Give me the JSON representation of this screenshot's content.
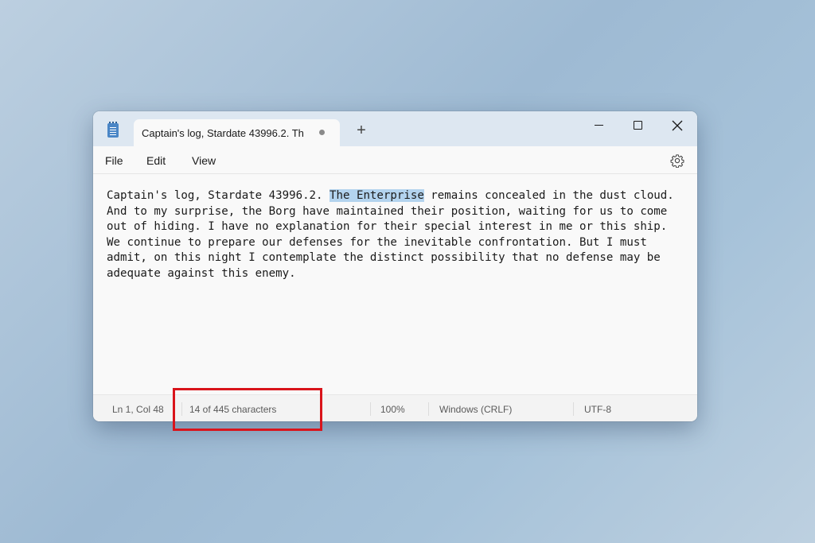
{
  "window": {
    "tab_title": "Captain's log, Stardate 43996.2. Th",
    "new_tab_symbol": "+"
  },
  "menu": {
    "file": "File",
    "edit": "Edit",
    "view": "View"
  },
  "editor": {
    "lines": [
      {
        "before": "Captain's log, Stardate 43996.2. ",
        "selected": "The Enterprise",
        "after": " remains concealed in the dust cloud."
      },
      {
        "before": "And to my surprise, the Borg have maintained their position, waiting for us to come",
        "selected": "",
        "after": ""
      },
      {
        "before": "out of hiding. I have no explanation for their special interest in me or this ship.",
        "selected": "",
        "after": ""
      },
      {
        "before": "We continue to prepare our defenses for the inevitable confrontation. But I must",
        "selected": "",
        "after": ""
      },
      {
        "before": "admit, on this night I contemplate the distinct possibility that no defense may be",
        "selected": "",
        "after": ""
      },
      {
        "before": "adequate against this enemy.",
        "selected": "",
        "after": ""
      }
    ],
    "selection_color": "#b3d3ee"
  },
  "status": {
    "position": "Ln 1, Col 48",
    "characters": "14 of 445 characters",
    "zoom": "100%",
    "line_ending": "Windows (CRLF)",
    "encoding": "UTF-8"
  },
  "icons": {
    "app": "notepad-icon",
    "settings": "gear-icon",
    "minimize": "minimize-icon",
    "maximize": "maximize-icon",
    "close": "close-icon"
  },
  "annotation": {
    "highlight_color": "#d9141b"
  }
}
